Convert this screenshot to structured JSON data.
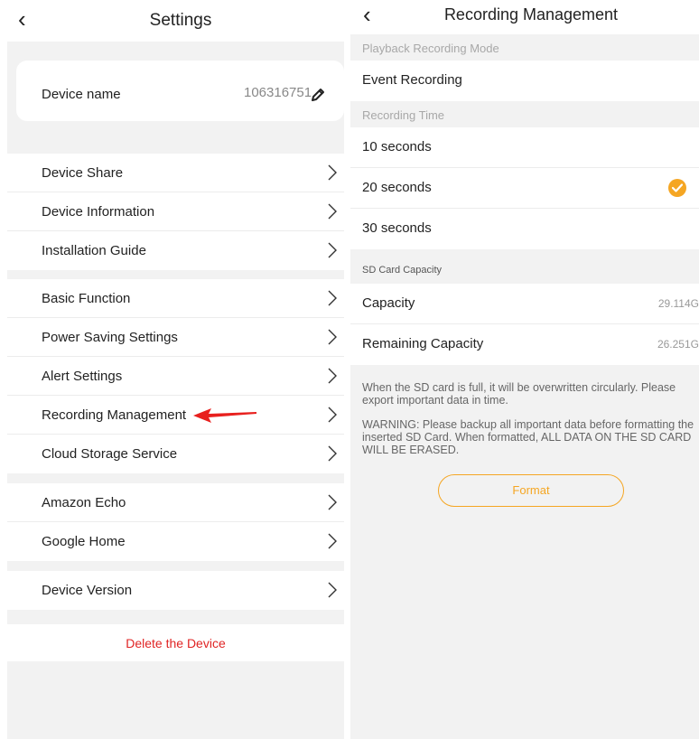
{
  "settings": {
    "title": "Settings",
    "device_name_label": "Device name",
    "device_name_value": "106316751",
    "groups": [
      [
        "Device Share",
        "Device Information",
        "Installation Guide"
      ],
      [
        "Basic Function",
        "Power Saving Settings",
        "Alert Settings",
        "Recording Management",
        "Cloud Storage Service"
      ],
      [
        "Amazon Echo",
        "Google Home"
      ],
      [
        "Device Version"
      ]
    ],
    "delete_label": "Delete the Device"
  },
  "recording": {
    "title": "Recording Management",
    "playback_mode_label": "Playback Recording Mode",
    "playback_mode_value": "Event Recording",
    "recording_time_label": "Recording Time",
    "times": [
      "10 seconds",
      "20 seconds",
      "30 seconds"
    ],
    "selected_time": "20 seconds",
    "sd_label": "SD Card Capacity",
    "capacity_label": "Capacity",
    "capacity_value": "29.114G",
    "remaining_label": "Remaining Capacity",
    "remaining_value": "26.251G",
    "notice_1": "When the SD card is full, it will be overwritten circularly. Please export important data in time.",
    "notice_2": "WARNING: Please backup all important data before formatting the inserted SD Card. When formatted, ALL DATA ON THE SD CARD WILL BE ERASED.",
    "format_label": "Format"
  },
  "colors": {
    "accent": "#f5a623",
    "danger": "#e02424",
    "background": "#f2f2f2"
  },
  "icons": {
    "back": "back-chevron-icon",
    "edit": "pencil-icon",
    "row": "chevron-right-icon",
    "selected": "checkmark-circle-icon",
    "annotation": "red-arrow-icon"
  }
}
